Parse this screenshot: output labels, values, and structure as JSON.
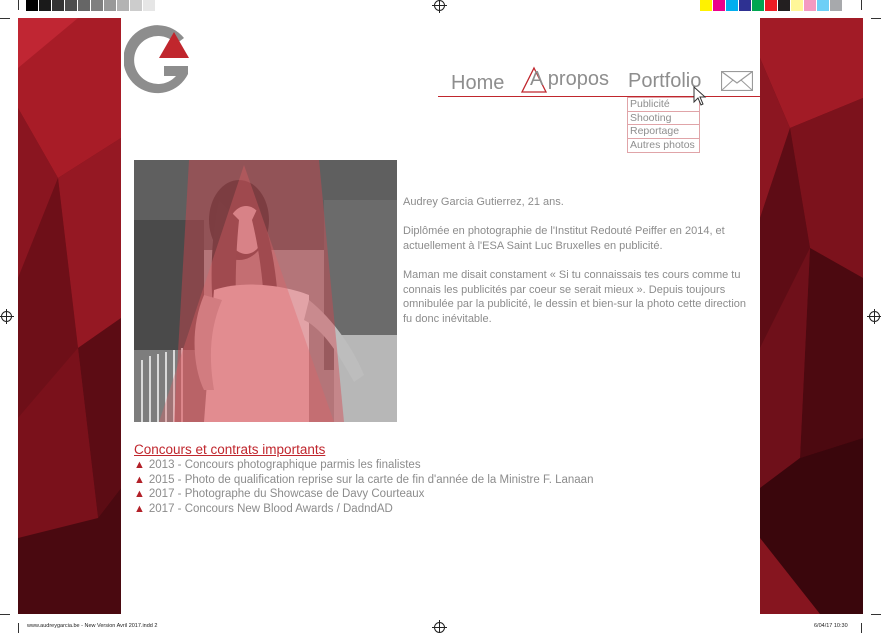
{
  "colors": {
    "accent": "#c0262d",
    "text": "#8c8c8c",
    "panel_dark": "#5a0d16",
    "panel_mid": "#8e1620",
    "panel_light": "#b52230"
  },
  "print_marks": {
    "gray_swatches": [
      "#000000",
      "#1a1a1a",
      "#333333",
      "#4d4d4d",
      "#666666",
      "#808080",
      "#999999",
      "#b3b3b3",
      "#cccccc",
      "#e6e6e6",
      "#ffffff"
    ],
    "color_swatches": [
      "#fff200",
      "#ec008c",
      "#00aeef",
      "#2e3192",
      "#00a651",
      "#ed1c24",
      "#231f20",
      "#fff799",
      "#f49ac1",
      "#6dcff6",
      "#a7a9ac"
    ],
    "footer_left": "www.audreygarcia.be - New Version Avril 2017.indd   2",
    "footer_right": "6/04/17   10:30"
  },
  "logo": {
    "alt": "G"
  },
  "nav": {
    "home": "Home",
    "apropos": "A propos",
    "portfolio": "Portfolio",
    "mail_icon": "envelope-icon",
    "submenu": [
      "Publicité",
      "Shooting",
      "Reportage",
      "Autres photos"
    ]
  },
  "bio": {
    "line1": "Audrey Garcia Gutierrez, 21 ans.",
    "line2": "Diplômée en photographie de l'Institut Redouté Peiffer en 2014, et actuellement à l'ESA Saint Luc Bruxelles en publicité.",
    "line3": "Maman me disait constament « Si tu connaissais tes cours comme tu connais les publicités par coeur se serait mieux ». Depuis toujours omnibulée par la publicité, le dessin et bien-sur la photo cette direction fu donc inévitable."
  },
  "contests": {
    "title": "Concours et contrats importants",
    "bullet": "▲",
    "items": [
      "2013 - Concours photographique parmis les finalistes",
      "2015 - Photo de qualification reprise sur la carte de fin d'année de la Ministre F. Lanaan",
      "2017 - Photographe du Showcase de Davy Courteaux",
      "2017 - Concours New Blood Awards / DadndAD"
    ]
  }
}
